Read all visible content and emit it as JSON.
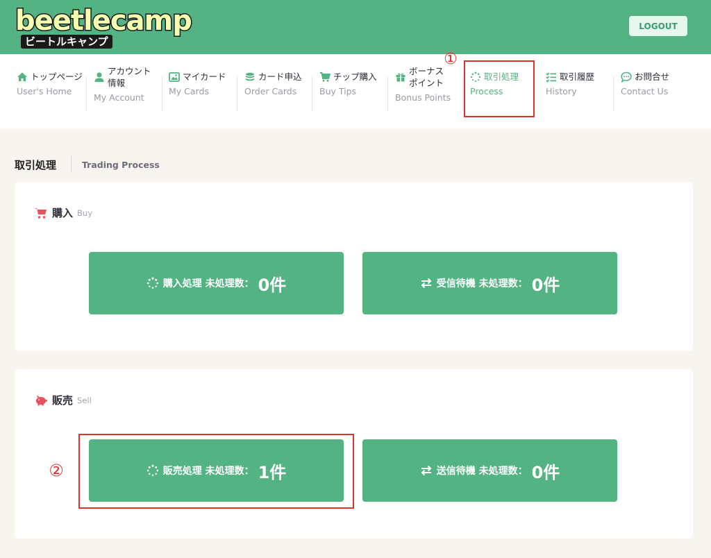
{
  "header": {
    "logo_main": "beetlecamp",
    "logo_sub": "ビートルキャンプ",
    "logout_label": "LOGOUT"
  },
  "nav": {
    "items": [
      {
        "jp": "トップページ",
        "en": "User's Home",
        "icon": "home-icon"
      },
      {
        "jp": "アカウント\n情報",
        "en": "My Account",
        "icon": "user-icon"
      },
      {
        "jp": "マイカード",
        "en": "My Cards",
        "icon": "cards-icon"
      },
      {
        "jp": "カード申込",
        "en": "Order Cards",
        "icon": "coins-icon"
      },
      {
        "jp": "チップ購入",
        "en": "Buy Tips",
        "icon": "cart-icon"
      },
      {
        "jp": "ボーナス\nポイント",
        "en": "Bonus Points",
        "icon": "gift-icon"
      },
      {
        "jp": "取引処理",
        "en": "Process",
        "icon": "spinner-icon",
        "active": true
      },
      {
        "jp": "取引履歴",
        "en": "History",
        "icon": "list-check-icon"
      },
      {
        "jp": "お問合せ",
        "en": "Contact Us",
        "icon": "chat-icon"
      }
    ]
  },
  "annotations": {
    "one": "①",
    "two": "②"
  },
  "page": {
    "title": "取引処理",
    "subtitle": "Trading Process"
  },
  "buy": {
    "title": "購入",
    "subtitle": "Buy",
    "cards": [
      {
        "label": "購入処理 未処理数：",
        "count": "0件",
        "icon": "spinner-icon"
      },
      {
        "label": "受信待機 未処理数：",
        "count": "0件",
        "icon": "exchange-icon"
      }
    ]
  },
  "sell": {
    "title": "販売",
    "subtitle": "Sell",
    "cards": [
      {
        "label": "販売処理 未処理数：",
        "count": "1件",
        "icon": "spinner-icon"
      },
      {
        "label": "送信待機 未処理数：",
        "count": "0件",
        "icon": "exchange-icon"
      }
    ]
  },
  "colors": {
    "brand_green": "#53b382",
    "annotation_red": "#d9332b",
    "icon_red": "#e8505b"
  }
}
